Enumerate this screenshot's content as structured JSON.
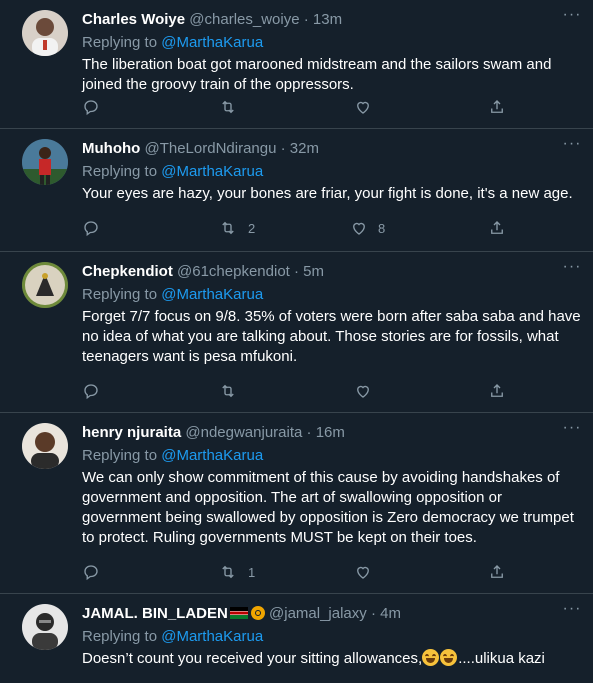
{
  "colors": {
    "background": "#15202b",
    "link": "#1d9bf0",
    "muted": "#8899a6",
    "divider": "#38444d"
  },
  "tweets": [
    {
      "name": "Charles Woiye",
      "handle": "@charles_woiye",
      "sep": " · ",
      "time": "13m",
      "reply_prefix": "Replying to ",
      "reply_to": "@MarthaKarua",
      "text": "The liberation boat got marooned midstream and the sailors swam and joined the groovy train of the oppressors.",
      "retweets": "",
      "likes": ""
    },
    {
      "name": "Muhoho",
      "handle": "@TheLordNdirangu",
      "sep": " · ",
      "time": "32m",
      "reply_prefix": "Replying to ",
      "reply_to": "@MarthaKarua",
      "text": "Your eyes are hazy, your bones are friar, your fight is done, it's a new age.",
      "retweets": "2",
      "likes": "8"
    },
    {
      "name": "Chepkendiot",
      "handle": "@61chepkendiot",
      "sep": " · ",
      "time": "5m",
      "reply_prefix": "Replying to ",
      "reply_to": "@MarthaKarua",
      "text": "Forget 7/7 focus on 9/8. 35% of voters were born after saba saba and have no idea of what you are talking about. Those stories are for fossils, what teenagers want is pesa mfukoni.",
      "retweets": "",
      "likes": ""
    },
    {
      "name": "henry njuraita",
      "handle": "@ndegwanjuraita",
      "sep": " · ",
      "time": "16m",
      "reply_prefix": "Replying to ",
      "reply_to": "@MarthaKarua",
      "text": "We can only show commitment of this cause by avoiding handshakes of government and opposition. The art of swallowing opposition or government being swallowed by opposition is Zero democracy we trumpet to protect. Ruling governments MUST be kept on their toes.",
      "retweets": "1",
      "likes": ""
    },
    {
      "name": "JAMAL. BIN_LADEN",
      "handle": "@jamal_jalaxy",
      "sep": " · ",
      "time": "4m",
      "reply_prefix": "Replying to ",
      "reply_to": "@MarthaKarua",
      "text": "Doesn’t count you received your sitting allowances,",
      "text_tail": "....ulikua kazi",
      "retweets": "",
      "likes": ""
    }
  ],
  "icons": {
    "reply": "reply-icon",
    "retweet": "retweet-icon",
    "like": "heart-icon",
    "share": "share-icon",
    "more": "more-icon"
  }
}
